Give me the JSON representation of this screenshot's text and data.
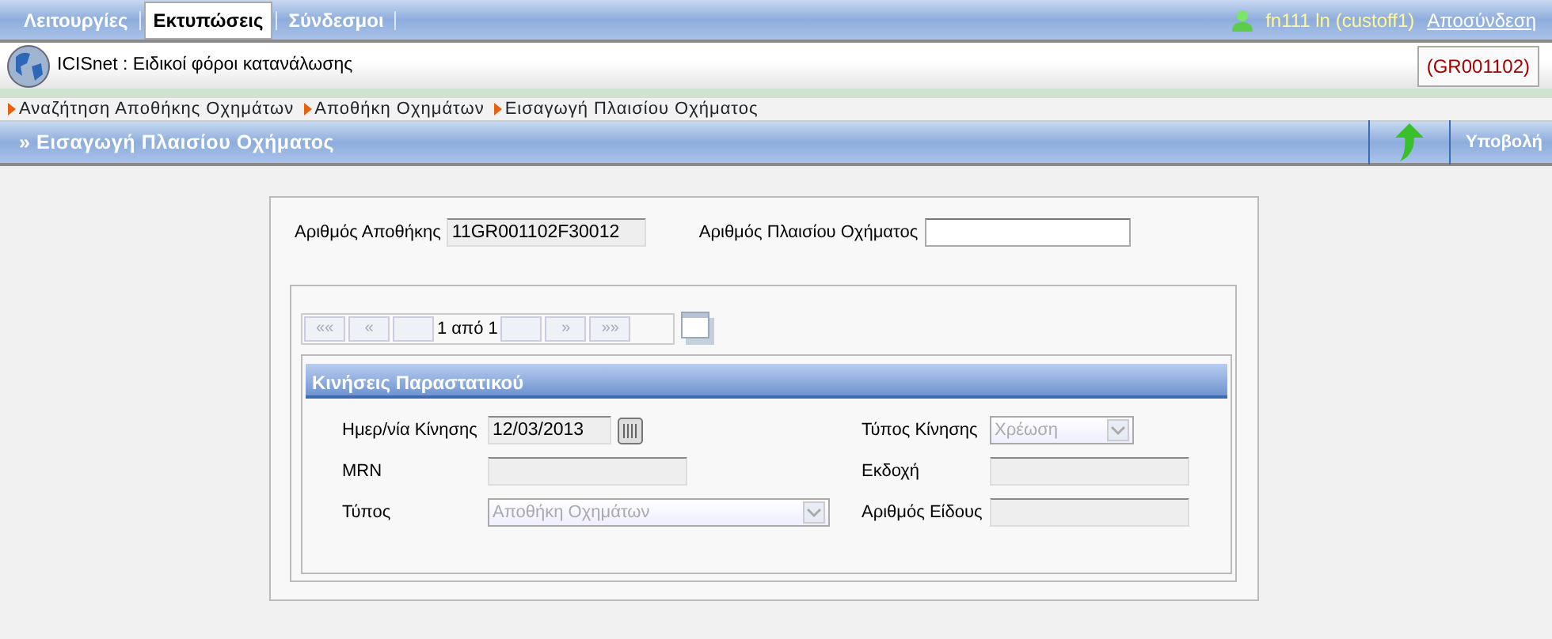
{
  "menu": [
    {
      "label": "Λειτουργίες",
      "selected": false
    },
    {
      "label": "Εκτυπώσεις",
      "selected": true
    },
    {
      "label": "Σύνδεσμοι",
      "selected": false
    }
  ],
  "user": {
    "name": "fn111 ln (custoff1)",
    "logout": "Αποσύνδεση"
  },
  "app_title": "ICISnet : Ειδικοί φόροι κατανάλωσης",
  "office_code": "(GR001102)",
  "breadcrumbs": [
    "Αναζήτηση Αποθήκης Οχημάτων",
    "Αποθήκη Οχημάτων",
    "Εισαγωγή Πλαισίου Οχήματος"
  ],
  "page_title": "» Εισαγωγή Πλαισίου Οχήματος",
  "submit_label": "Υποβολή",
  "header_fields": [
    {
      "label": "Αριθμός Αποθήκης",
      "value": "11GR001102F30012",
      "disabled": true
    },
    {
      "label": "Αριθμός Πλαισίου Οχήματος",
      "disabled": false
    }
  ],
  "pager": {
    "buttons": [
      {
        "label": "««",
        "disabled": true
      },
      {
        "label": "«",
        "disabled": true
      },
      {
        "label": "»",
        "disabled": true
      },
      {
        "label": "»»",
        "disabled": true
      }
    ],
    "page_text": "1 από 1"
  },
  "section": {
    "title": "Κινήσεις Παραστατικού",
    "left_fields": [
      {
        "kind": "date",
        "label": "Ημερ/νία Κίνησης",
        "value": "12/03/2013",
        "disabled": true
      },
      {
        "kind": "text",
        "label": "MRN",
        "disabled": true
      },
      {
        "kind": "select",
        "label": "Τύπος",
        "value": "Αποθήκη Οχημάτων",
        "disabled": true
      }
    ],
    "right_fields": [
      {
        "kind": "select",
        "label": "Τύπος Κίνησης",
        "value": "Χρέωση",
        "disabled": true
      },
      {
        "kind": "text",
        "label": "Εκδοχή",
        "disabled": true
      },
      {
        "kind": "text",
        "label": "Αριθμός Είδους",
        "disabled": true
      }
    ]
  }
}
